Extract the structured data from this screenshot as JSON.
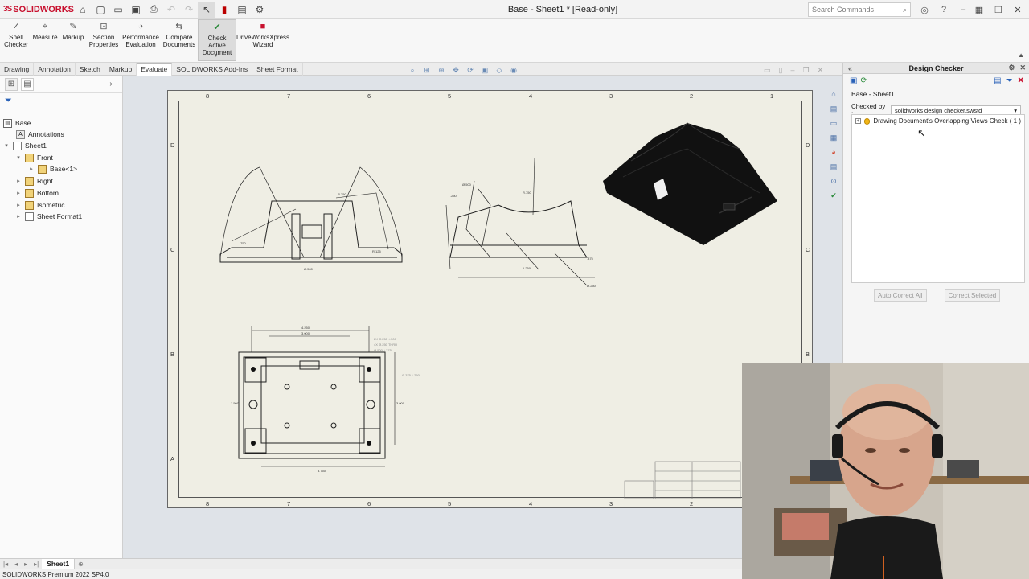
{
  "app": {
    "brand": "SOLIDWORKS",
    "window_title": "Base - Sheet1 * [Read-only]",
    "search_placeholder": "Search Commands"
  },
  "ribbon": {
    "buttons": [
      {
        "label": "Spell Checker",
        "icon": "spell-check-icon"
      },
      {
        "label": "Measure",
        "icon": "measure-icon"
      },
      {
        "label": "Markup",
        "icon": "markup-icon"
      },
      {
        "label": "Section Properties",
        "icon": "section-properties-icon"
      },
      {
        "label": "Performance Evaluation",
        "icon": "performance-icon"
      },
      {
        "label": "Compare Documents",
        "icon": "compare-icon"
      },
      {
        "label": "Check Active Document",
        "icon": "check-document-icon"
      },
      {
        "label": "DriveWorksXpress Wizard",
        "icon": "driveworks-icon"
      }
    ]
  },
  "tabs": [
    "Drawing",
    "Annotation",
    "Sketch",
    "Markup",
    "Evaluate",
    "SOLIDWORKS Add-Ins",
    "Sheet Format"
  ],
  "active_tab": "Evaluate",
  "tree": {
    "root": "Base",
    "items": [
      "Annotations",
      "Sheet1",
      "Front",
      "Base<1>",
      "Right",
      "Bottom",
      "Isometric",
      "Sheet Format1"
    ]
  },
  "sheet": {
    "zones_top": [
      "8",
      "7",
      "6",
      "5",
      "4",
      "3",
      "2",
      "1"
    ],
    "zones_bottom": [
      "8",
      "7",
      "6",
      "5",
      "4",
      "3",
      "2"
    ],
    "zones_left": [
      "D",
      "C",
      "B",
      "A"
    ],
    "zones_right": [
      "D",
      "C",
      "B"
    ]
  },
  "sheet_tabs": {
    "active": "Sheet1"
  },
  "status_bar": "SOLIDWORKS Premium 2022 SP4.0",
  "design_checker": {
    "title": "Design Checker",
    "document": "Base - Sheet1",
    "checked_by_label": "Checked by :",
    "checked_by_value": "solidworks design checker.swstd",
    "result": "Drawing Document's Overlapping Views Check ( 1 )",
    "auto_correct": "Auto Correct All",
    "correct_selected": "Correct Selected"
  },
  "colors": {
    "brand_red": "#c8102e",
    "sheet_bg": "#efeee4",
    "warning": "#f2b517"
  }
}
